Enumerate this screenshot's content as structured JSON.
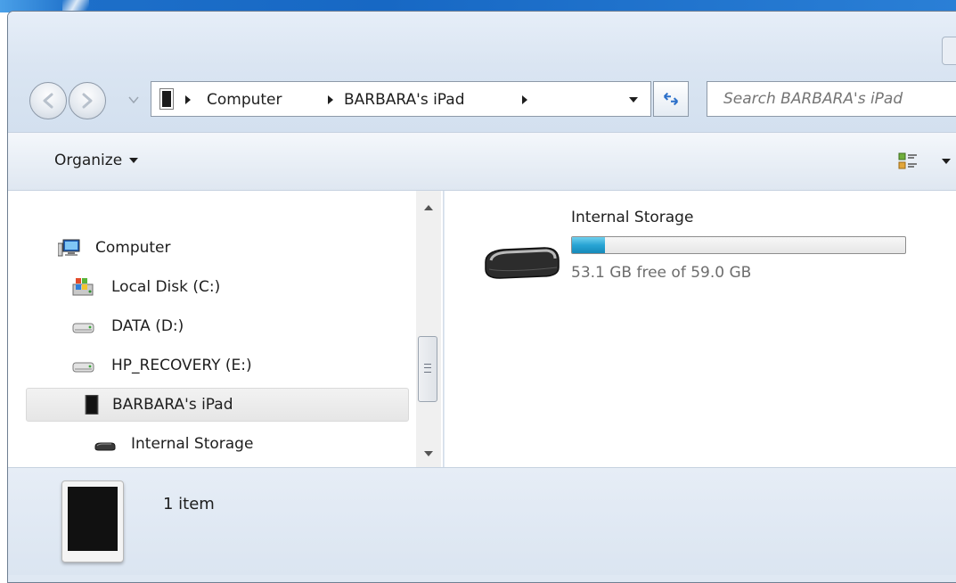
{
  "address_bar": {
    "crumbs": [
      "Computer",
      "BARBARA's iPad"
    ]
  },
  "search": {
    "placeholder": "Search BARBARA's iPad"
  },
  "command_bar": {
    "organize_label": "Organize"
  },
  "navigation": {
    "items": [
      {
        "label": "Computer",
        "icon": "computer-icon"
      },
      {
        "label": "Local Disk (C:)",
        "icon": "windows-drive-icon"
      },
      {
        "label": "DATA (D:)",
        "icon": "hard-drive-icon"
      },
      {
        "label": "HP_RECOVERY (E:)",
        "icon": "hard-drive-icon"
      },
      {
        "label": "BARBARA's iPad",
        "icon": "ipad-icon",
        "selected": true
      },
      {
        "label": "Internal Storage",
        "icon": "storage-icon"
      }
    ]
  },
  "content": {
    "drives": [
      {
        "name": "Internal Storage",
        "free_text": "53.1 GB free of 59.0 GB",
        "used_fraction": 0.1
      }
    ]
  },
  "details": {
    "item_count": "1 item"
  },
  "colors": {
    "capacity_fill": "#28a4d4",
    "selection_bg": "#e6e6e6"
  }
}
